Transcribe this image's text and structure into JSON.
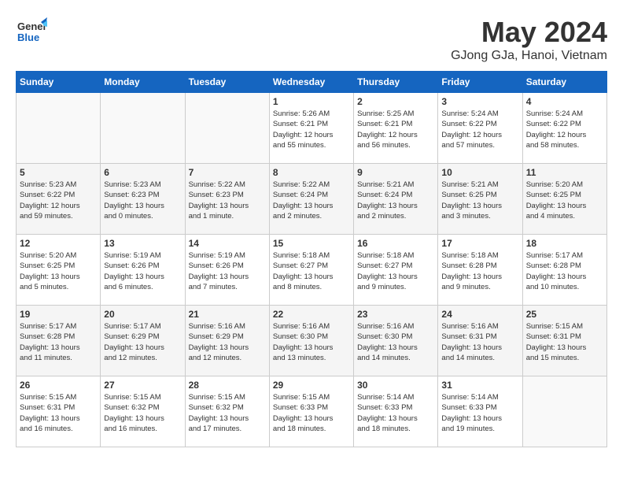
{
  "header": {
    "logo_general": "General",
    "logo_blue": "Blue",
    "month_title": "May 2024",
    "location": "GJong GJa, Hanoi, Vietnam"
  },
  "days_of_week": [
    "Sunday",
    "Monday",
    "Tuesday",
    "Wednesday",
    "Thursday",
    "Friday",
    "Saturday"
  ],
  "weeks": [
    [
      {
        "day": "",
        "info": ""
      },
      {
        "day": "",
        "info": ""
      },
      {
        "day": "",
        "info": ""
      },
      {
        "day": "1",
        "info": "Sunrise: 5:26 AM\nSunset: 6:21 PM\nDaylight: 12 hours\nand 55 minutes."
      },
      {
        "day": "2",
        "info": "Sunrise: 5:25 AM\nSunset: 6:21 PM\nDaylight: 12 hours\nand 56 minutes."
      },
      {
        "day": "3",
        "info": "Sunrise: 5:24 AM\nSunset: 6:22 PM\nDaylight: 12 hours\nand 57 minutes."
      },
      {
        "day": "4",
        "info": "Sunrise: 5:24 AM\nSunset: 6:22 PM\nDaylight: 12 hours\nand 58 minutes."
      }
    ],
    [
      {
        "day": "5",
        "info": "Sunrise: 5:23 AM\nSunset: 6:22 PM\nDaylight: 12 hours\nand 59 minutes."
      },
      {
        "day": "6",
        "info": "Sunrise: 5:23 AM\nSunset: 6:23 PM\nDaylight: 13 hours\nand 0 minutes."
      },
      {
        "day": "7",
        "info": "Sunrise: 5:22 AM\nSunset: 6:23 PM\nDaylight: 13 hours\nand 1 minute."
      },
      {
        "day": "8",
        "info": "Sunrise: 5:22 AM\nSunset: 6:24 PM\nDaylight: 13 hours\nand 2 minutes."
      },
      {
        "day": "9",
        "info": "Sunrise: 5:21 AM\nSunset: 6:24 PM\nDaylight: 13 hours\nand 2 minutes."
      },
      {
        "day": "10",
        "info": "Sunrise: 5:21 AM\nSunset: 6:25 PM\nDaylight: 13 hours\nand 3 minutes."
      },
      {
        "day": "11",
        "info": "Sunrise: 5:20 AM\nSunset: 6:25 PM\nDaylight: 13 hours\nand 4 minutes."
      }
    ],
    [
      {
        "day": "12",
        "info": "Sunrise: 5:20 AM\nSunset: 6:25 PM\nDaylight: 13 hours\nand 5 minutes."
      },
      {
        "day": "13",
        "info": "Sunrise: 5:19 AM\nSunset: 6:26 PM\nDaylight: 13 hours\nand 6 minutes."
      },
      {
        "day": "14",
        "info": "Sunrise: 5:19 AM\nSunset: 6:26 PM\nDaylight: 13 hours\nand 7 minutes."
      },
      {
        "day": "15",
        "info": "Sunrise: 5:18 AM\nSunset: 6:27 PM\nDaylight: 13 hours\nand 8 minutes."
      },
      {
        "day": "16",
        "info": "Sunrise: 5:18 AM\nSunset: 6:27 PM\nDaylight: 13 hours\nand 9 minutes."
      },
      {
        "day": "17",
        "info": "Sunrise: 5:18 AM\nSunset: 6:28 PM\nDaylight: 13 hours\nand 9 minutes."
      },
      {
        "day": "18",
        "info": "Sunrise: 5:17 AM\nSunset: 6:28 PM\nDaylight: 13 hours\nand 10 minutes."
      }
    ],
    [
      {
        "day": "19",
        "info": "Sunrise: 5:17 AM\nSunset: 6:28 PM\nDaylight: 13 hours\nand 11 minutes."
      },
      {
        "day": "20",
        "info": "Sunrise: 5:17 AM\nSunset: 6:29 PM\nDaylight: 13 hours\nand 12 minutes."
      },
      {
        "day": "21",
        "info": "Sunrise: 5:16 AM\nSunset: 6:29 PM\nDaylight: 13 hours\nand 12 minutes."
      },
      {
        "day": "22",
        "info": "Sunrise: 5:16 AM\nSunset: 6:30 PM\nDaylight: 13 hours\nand 13 minutes."
      },
      {
        "day": "23",
        "info": "Sunrise: 5:16 AM\nSunset: 6:30 PM\nDaylight: 13 hours\nand 14 minutes."
      },
      {
        "day": "24",
        "info": "Sunrise: 5:16 AM\nSunset: 6:31 PM\nDaylight: 13 hours\nand 14 minutes."
      },
      {
        "day": "25",
        "info": "Sunrise: 5:15 AM\nSunset: 6:31 PM\nDaylight: 13 hours\nand 15 minutes."
      }
    ],
    [
      {
        "day": "26",
        "info": "Sunrise: 5:15 AM\nSunset: 6:31 PM\nDaylight: 13 hours\nand 16 minutes."
      },
      {
        "day": "27",
        "info": "Sunrise: 5:15 AM\nSunset: 6:32 PM\nDaylight: 13 hours\nand 16 minutes."
      },
      {
        "day": "28",
        "info": "Sunrise: 5:15 AM\nSunset: 6:32 PM\nDaylight: 13 hours\nand 17 minutes."
      },
      {
        "day": "29",
        "info": "Sunrise: 5:15 AM\nSunset: 6:33 PM\nDaylight: 13 hours\nand 18 minutes."
      },
      {
        "day": "30",
        "info": "Sunrise: 5:14 AM\nSunset: 6:33 PM\nDaylight: 13 hours\nand 18 minutes."
      },
      {
        "day": "31",
        "info": "Sunrise: 5:14 AM\nSunset: 6:33 PM\nDaylight: 13 hours\nand 19 minutes."
      },
      {
        "day": "",
        "info": ""
      }
    ]
  ]
}
